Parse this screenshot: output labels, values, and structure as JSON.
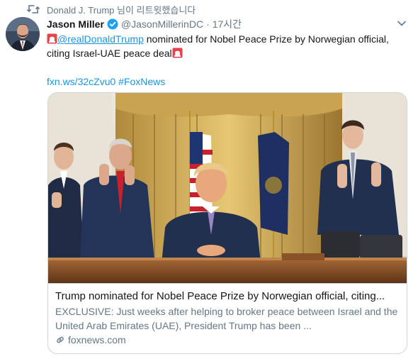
{
  "retweet_context": {
    "text": "Donald J. Trump 님이 리트윗했습니다",
    "icon": "retweet-icon"
  },
  "author": {
    "display_name": "Jason Miller",
    "handle": "@JasonMillerinDC",
    "separator": "·",
    "timestamp": "17시간",
    "verified": true
  },
  "tweet": {
    "mention": "@realDonaldTrump",
    "text": " nominated for Nobel Peace Prize by Norwegian official, citing Israel-UAE peace deal",
    "link": "fxn.ws/32cZvu0",
    "hashtag": "#FoxNews"
  },
  "card": {
    "title": "Trump nominated for Nobel Peace Prize by Norwegian official, citing...",
    "description": "EXCLUSIVE: Just weeks after helping to broker peace between Israel and the United Arab Emirates (UAE), President Trump has been ...",
    "domain": "foxnews.com"
  },
  "colors": {
    "link": "#1b95e0",
    "secondary_text": "#657786",
    "border": "#ccd6dd",
    "verified": "#1da1f2"
  }
}
